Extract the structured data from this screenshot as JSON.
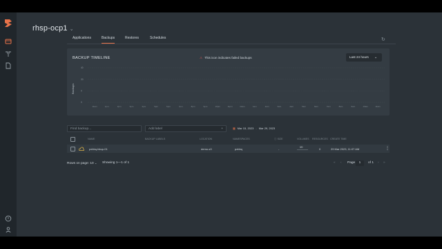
{
  "project": {
    "name": "rhsp-ocp1"
  },
  "tabs": [
    {
      "label": "Applications"
    },
    {
      "label": "Backups"
    },
    {
      "label": "Restores"
    },
    {
      "label": "Schedules"
    }
  ],
  "timeline": {
    "title": "BACKUP TIMELINE",
    "legend_note": "This icon indicates failed backups",
    "range_label": "Last 24 hours",
    "ylabel": "Backups",
    "yticks": [
      "40",
      "20",
      "0",
      "0"
    ],
    "xticks": [
      "11am",
      "1pm",
      "2pm",
      "3pm",
      "4pm",
      "5pm",
      "6pm",
      "7pm",
      "8pm",
      "9pm",
      "10pm",
      "11pm",
      "12am",
      "1am",
      "2am",
      "3am",
      "4am",
      "5am",
      "6am",
      "7am",
      "8am",
      "9am",
      "10am",
      "11am"
    ]
  },
  "toolbar": {
    "search_placeholder": "Find backup...",
    "label_placeholder": "Add label",
    "date_from": "Mar 15, 2023",
    "date_to": "Mar 29, 2023"
  },
  "table": {
    "columns": {
      "name": "NAME",
      "labels": "BACKUP LABELS",
      "location": "LOCATION",
      "namespaces": "NAMESPACES",
      "size": "SIZE",
      "volumes": "VOLUMES",
      "resources": "RESOURCES",
      "create_time": "CREATE TIME"
    },
    "rows": [
      {
        "name": "pxbbq-bkup-01",
        "labels": "",
        "location": "demo-s3",
        "namespaces": "pxbbq",
        "size": "-",
        "volumes": "0/0",
        "resources": "0",
        "create_time": "29 Mar 2023, 11:07 AM"
      }
    ]
  },
  "pagination": {
    "rows_per_page_label": "Rows on page: 10",
    "showing": "Showing 1—1 of 1",
    "page_label": "Page",
    "page_value": "1",
    "of_label": "of 1"
  },
  "colors": {
    "accent": "#e8734a",
    "failed": "#e05858"
  }
}
